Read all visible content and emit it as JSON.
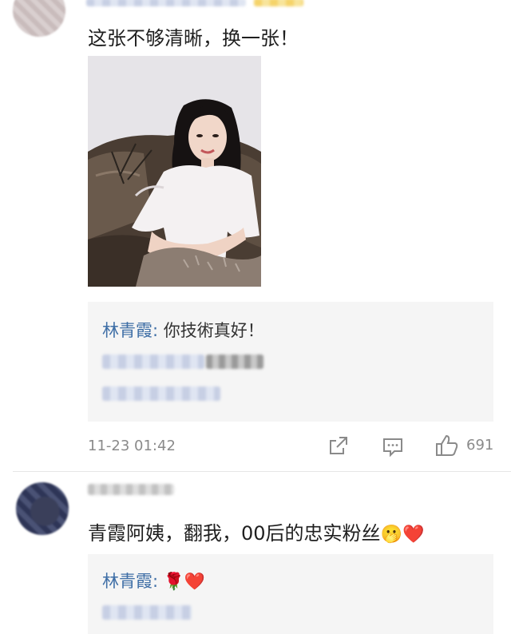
{
  "comment1": {
    "text": "这张不够清晰，换一张！",
    "reply": {
      "name": "林青霞",
      "separator": ":",
      "text": "你技術真好！"
    },
    "timestamp": "11-23 01:42",
    "like_count": "691"
  },
  "comment2": {
    "text": "青霞阿姨，翻我，00后的忠实粉丝",
    "emojis": [
      "🫢",
      "❤️"
    ],
    "reply": {
      "name": "林青霞",
      "separator": ":",
      "emojis": [
        "🌹",
        "❤️"
      ]
    }
  },
  "icons": [
    "share-icon",
    "comment-icon",
    "thumbs-up-icon"
  ],
  "colors": {
    "name_link": "#3e6ea6",
    "meta_gray": "#8a8a8a",
    "quote_bg": "#f5f5f5",
    "heart": "#e0202a"
  }
}
